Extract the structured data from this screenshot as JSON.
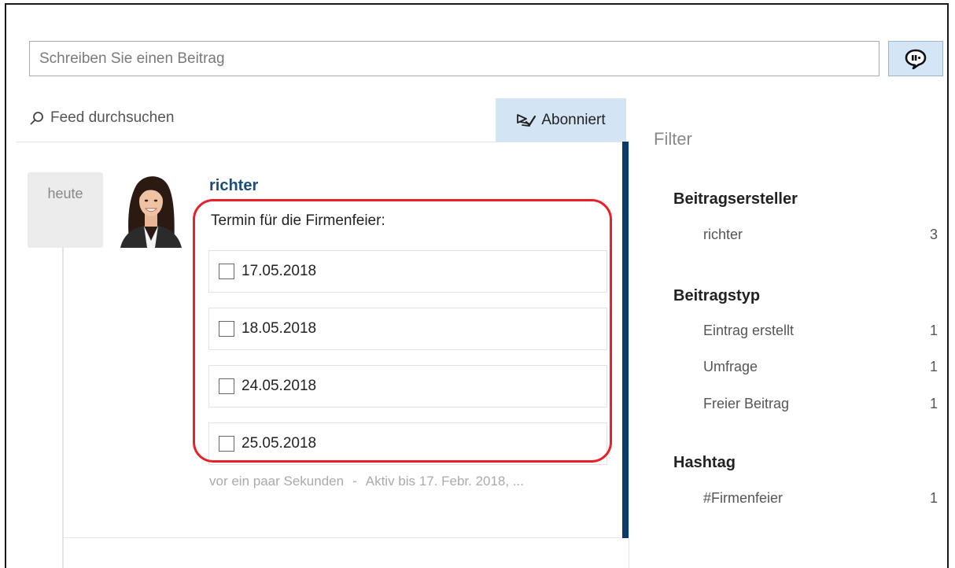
{
  "composer": {
    "placeholder": "Schreiben Sie einen Beitrag",
    "post_icon": "speech-bubble-icon"
  },
  "toolbar": {
    "search_label": "Feed durchsuchen",
    "search_icon": "search-icon",
    "subscribe_label": "Abonniert",
    "subscribe_icon": "subscribe-icon"
  },
  "post": {
    "date_label": "heute",
    "author": "richter",
    "text": "Termin für die Firmenfeier:",
    "poll_options": [
      "17.05.2018",
      "18.05.2018",
      "24.05.2018",
      "25.05.2018"
    ],
    "time_ago": "vor ein paar Sekunden",
    "separator": "-",
    "active_until": "Aktiv bis 17. Febr. 2018, ..."
  },
  "filter": {
    "title": "Filter",
    "groups": [
      {
        "title": "Beitragsersteller",
        "items": [
          {
            "label": "richter",
            "count": "3"
          }
        ]
      },
      {
        "title": "Beitragstyp",
        "items": [
          {
            "label": "Eintrag erstellt",
            "count": "1"
          },
          {
            "label": "Umfrage",
            "count": "1"
          },
          {
            "label": "Freier Beitrag",
            "count": "1"
          }
        ]
      },
      {
        "title": "Hashtag",
        "items": [
          {
            "label": "#Firmenfeier",
            "count": "1"
          }
        ]
      }
    ]
  },
  "colors": {
    "accent": "#0b3a66",
    "button_bg": "#d4e6f6",
    "highlight": "#e8202a",
    "author_link": "#1a4c7c"
  }
}
